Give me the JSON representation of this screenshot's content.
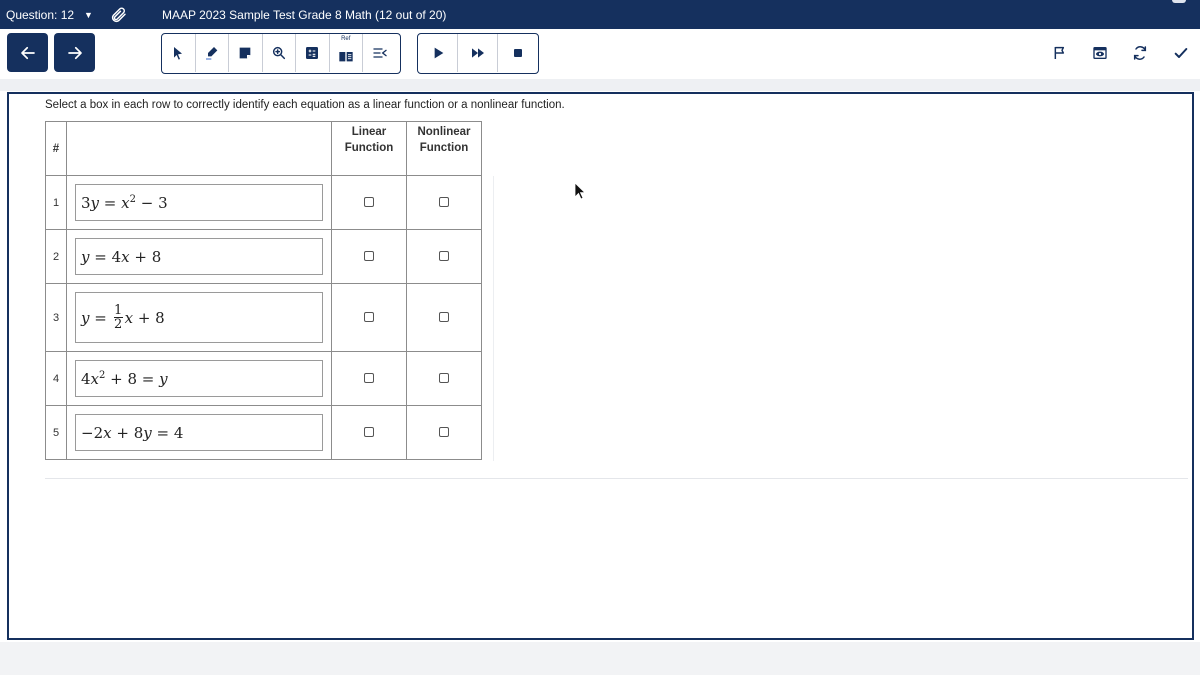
{
  "header": {
    "question_label": "Question: 12",
    "test_title": "MAAP 2023 Sample Test Grade 8 Math (12 out of 20)"
  },
  "toolbar": {
    "tools": [
      "pointer-icon",
      "highlighter-icon",
      "sticky-note-icon",
      "zoom-icon",
      "calculator-icon",
      "reference-icon",
      "line-reader-icon"
    ],
    "ref_label": "Ref",
    "media": [
      "play-icon",
      "fast-forward-icon",
      "stop-icon"
    ],
    "right": [
      "flag-icon",
      "preview-icon",
      "refresh-icon",
      "checkmark-icon"
    ]
  },
  "question": {
    "prompt": "Select a box in each row to correctly identify each equation as a linear function or a nonlinear function.",
    "headers": {
      "num": "#",
      "linear_1": "Linear",
      "linear_2": "Function",
      "nonlinear_1": "Nonlinear",
      "nonlinear_2": "Function"
    },
    "rows": [
      {
        "num": "1",
        "linear_checked": false,
        "nonlinear_checked": false
      },
      {
        "num": "2",
        "linear_checked": false,
        "nonlinear_checked": false
      },
      {
        "num": "3",
        "linear_checked": false,
        "nonlinear_checked": false
      },
      {
        "num": "4",
        "linear_checked": false,
        "nonlinear_checked": false
      },
      {
        "num": "5",
        "linear_checked": false,
        "nonlinear_checked": false
      }
    ],
    "eq": {
      "r1": {
        "a": "3",
        "b": "y",
        "c": " = ",
        "d": "x",
        "e": "2",
        "f": " − 3"
      },
      "r2": {
        "a": "y",
        "b": " = 4",
        "c": "x",
        "d": " + 8"
      },
      "r3": {
        "a": "y",
        "b": " = ",
        "num": "1",
        "den": "2",
        "c": "x",
        "d": " + 8"
      },
      "r4": {
        "a": "4",
        "b": "x",
        "c": "2",
        "d": " + 8 = ",
        "e": "y"
      },
      "r5": {
        "a": "−2",
        "b": "x",
        "c": " + 8",
        "d": "y",
        "e": " = 4"
      }
    }
  },
  "colors": {
    "brand_navy": "#15305e",
    "border_gray": "#8c8c8c"
  }
}
